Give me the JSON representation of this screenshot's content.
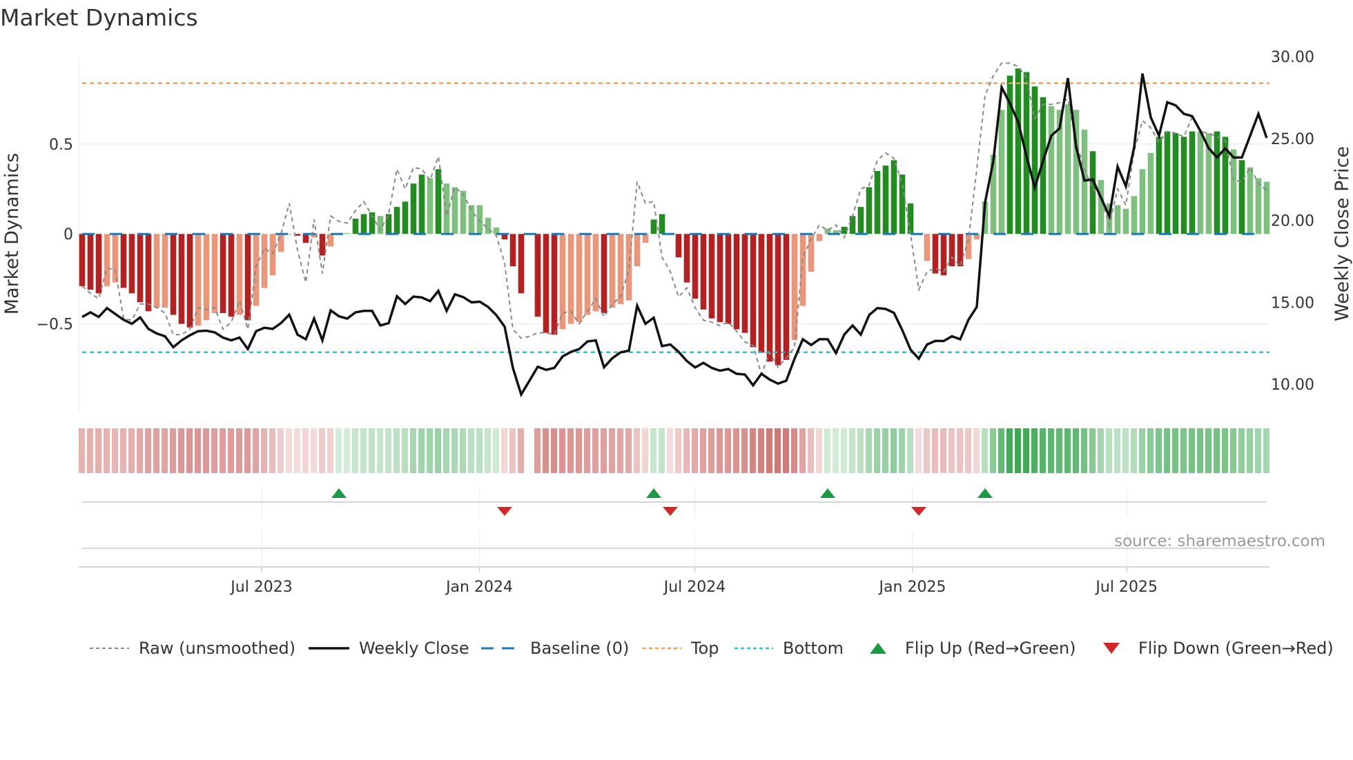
{
  "title": "Market Dynamics",
  "chart_data": {
    "type": "bar",
    "title": "Market Dynamics",
    "frequency": "weekly",
    "x_start": "2023-01-30",
    "ylabel_left": "Market Dynamics",
    "ylabel_right": "Weekly Close Price",
    "ylim_left": [
      -1.0,
      0.99
    ],
    "ylim_right": [
      8.2,
      30.04
    ],
    "yticks_left": [
      {
        "v": 0.5,
        "label": "0.5"
      },
      {
        "v": 0,
        "label": "0"
      },
      {
        "v": -0.5,
        "label": "−0.5"
      }
    ],
    "yticks_right": [
      {
        "v": 30,
        "label": "30.00"
      },
      {
        "v": 25,
        "label": "25.00"
      },
      {
        "v": 20,
        "label": "20.00"
      },
      {
        "v": 15,
        "label": "15.00"
      },
      {
        "v": 10,
        "label": "10.00"
      }
    ],
    "xticks": [
      {
        "week": 21.67,
        "label": "Jul 2023"
      },
      {
        "week": 47.96,
        "label": "Jan 2024"
      },
      {
        "week": 73.96,
        "label": "Jul 2024"
      },
      {
        "week": 100.25,
        "label": "Jan 2025"
      },
      {
        "week": 126.1,
        "label": "Jul 2025"
      }
    ],
    "top_level": 0.838,
    "bottom_level": -0.658,
    "baseline": 0,
    "colors": {
      "pos_strong": "#228b22",
      "pos_weak": "#7fbf7f",
      "neg_strong": "#b22222",
      "neg_weak": "#e9967a",
      "top": "#f0a050",
      "bottom": "#22c5d5",
      "baseline": "#1f77b4",
      "raw": "#888888",
      "close": "#111111",
      "flip_up": "#1a9a45",
      "flip_down": "#d62728"
    },
    "dynamics": [
      -0.29,
      -0.31,
      -0.33,
      -0.29,
      -0.27,
      -0.3,
      -0.33,
      -0.38,
      -0.43,
      -0.41,
      -0.41,
      -0.45,
      -0.5,
      -0.52,
      -0.51,
      -0.48,
      -0.44,
      -0.44,
      -0.46,
      -0.45,
      -0.48,
      -0.4,
      -0.3,
      -0.23,
      -0.1,
      -0.003,
      -0.01,
      -0.05,
      -0.02,
      -0.12,
      -0.07,
      0.005,
      0.005,
      0.085,
      0.11,
      0.12,
      0.1,
      0.11,
      0.15,
      0.18,
      0.28,
      0.33,
      0.31,
      0.36,
      0.28,
      0.26,
      0.24,
      0.16,
      0.16,
      0.09,
      0.036,
      -0.03,
      -0.18,
      -0.33,
      null,
      -0.46,
      -0.55,
      -0.56,
      -0.53,
      -0.5,
      -0.49,
      -0.45,
      -0.43,
      -0.44,
      -0.41,
      -0.39,
      -0.37,
      -0.18,
      -0.05,
      0.08,
      0.11,
      -0.004,
      -0.13,
      -0.27,
      -0.36,
      -0.42,
      -0.47,
      -0.49,
      -0.5,
      -0.53,
      -0.55,
      -0.63,
      -0.66,
      -0.71,
      -0.73,
      -0.7,
      -0.59,
      -0.4,
      -0.21,
      -0.04,
      0.03,
      0.02,
      0.04,
      0.1,
      0.15,
      0.26,
      0.35,
      0.38,
      0.41,
      0.33,
      0.17,
      -0.004,
      -0.15,
      -0.22,
      -0.23,
      -0.18,
      -0.18,
      -0.14,
      -0.03,
      0.18,
      0.44,
      0.69,
      0.88,
      0.92,
      0.9,
      0.82,
      0.76,
      0.71,
      0.69,
      0.72,
      0.69,
      0.58,
      0.46,
      0.3,
      0.17,
      0.16,
      0.14,
      0.21,
      0.36,
      0.45,
      0.54,
      0.57,
      0.56,
      0.54,
      0.57,
      0.57,
      0.56,
      0.57,
      0.54,
      0.47,
      0.41,
      0.37,
      0.31,
      0.29
    ],
    "shade": "dddllddddlldddlllddldlllllddldllldddldddddldllllllldddldddllllldllllldddddddddddddddddlllllldddddddddllddddllllldddddllllldllllllldddddllddldllllll",
    "raw": [
      -0.29,
      -0.33,
      -0.36,
      -0.19,
      -0.2,
      -0.47,
      -0.48,
      -0.39,
      -0.39,
      -0.41,
      -0.44,
      -0.56,
      -0.56,
      -0.53,
      -0.41,
      -0.42,
      -0.41,
      -0.53,
      -0.49,
      -0.37,
      -0.53,
      -0.18,
      -0.08,
      -0.11,
      0,
      0.17,
      -0.09,
      -0.27,
      0.08,
      -0.22,
      0.1,
      0.07,
      0.06,
      0.13,
      0.18,
      0.1,
      0.02,
      0.11,
      0.36,
      0.25,
      0.37,
      0.36,
      0.3,
      0.43,
      0.1,
      0.26,
      0.22,
      0.13,
      0.07,
      0.03,
      -0.01,
      -0.16,
      -0.53,
      -0.58,
      -0.57,
      -0.55,
      -0.55,
      -0.56,
      -0.44,
      -0.43,
      -0.5,
      -0.43,
      -0.36,
      -0.46,
      -0.39,
      -0.35,
      -0.2,
      0.29,
      0.17,
      0.18,
      -0.13,
      -0.21,
      -0.35,
      -0.3,
      -0.41,
      -0.48,
      -0.49,
      -0.51,
      -0.49,
      -0.54,
      -0.6,
      -0.62,
      -0.78,
      -0.66,
      -0.74,
      -0.69,
      -0.63,
      -0.13,
      -0.03,
      0.05,
      0.02,
      0.05,
      -0.02,
      0.1,
      0.25,
      0.27,
      0.41,
      0.45,
      0.42,
      0.28,
      0,
      -0.31,
      -0.21,
      -0.19,
      -0.21,
      -0.13,
      -0.18,
      -0.03,
      0.36,
      0.77,
      0.88,
      0.95,
      0.95,
      0.93,
      0.87,
      0.64,
      0.72,
      0.72,
      0.73,
      0.75,
      0.51,
      0.36,
      0.25,
      0.2,
      0.05,
      0.25,
      0.16,
      0.46,
      0.63,
      0.59,
      0.51,
      0.57,
      0.56,
      0.54,
      0.65,
      0.57,
      0.56,
      0.54,
      0.52,
      0.3,
      0.29,
      0.37,
      0.28,
      0.24
    ],
    "close": [
      14.11,
      14.39,
      14.11,
      14.65,
      14.29,
      13.94,
      13.69,
      14.08,
      13.38,
      13.1,
      12.93,
      12.26,
      12.68,
      12.99,
      13.24,
      13.27,
      13.17,
      12.85,
      12.68,
      12.85,
      12.15,
      13.24,
      13.45,
      13.38,
      13.73,
      14.25,
      13.03,
      12.75,
      14.01,
      12.68,
      14.51,
      14.15,
      14.01,
      14.39,
      14.48,
      14.48,
      13.59,
      13.73,
      15.37,
      14.9,
      15.35,
      15.3,
      15.07,
      15.7,
      14.48,
      15.49,
      15.32,
      15.0,
      15.04,
      14.72,
      14.22,
      13.52,
      11.0,
      9.38,
      10.22,
      11.07,
      10.88,
      11.0,
      11.7,
      11.98,
      12.15,
      12.61,
      12.68,
      11.04,
      11.59,
      11.95,
      12.05,
      14.79,
      13.69,
      14.06,
      12.33,
      12.43,
      11.98,
      11.42,
      11.03,
      11.31,
      11.0,
      10.83,
      10.93,
      10.64,
      10.6,
      9.94,
      10.64,
      10.29,
      10.04,
      10.22,
      11.56,
      12.75,
      12.4,
      12.75,
      12.75,
      11.91,
      13.03,
      13.59,
      13.03,
      14.22,
      14.65,
      14.6,
      14.36,
      13.31,
      12.12,
      11.56,
      12.43,
      12.65,
      12.64,
      12.93,
      12.75,
      13.94,
      14.72,
      21.1,
      23.63,
      28.12,
      27.14,
      26.01,
      23.91,
      22.01,
      23.63,
      25.17,
      25.62,
      28.68,
      24.47,
      22.43,
      22.5,
      21.38,
      20.26,
      23.28,
      22.08,
      24.47,
      28.96,
      26.29,
      25.17,
      27.21,
      27.02,
      26.5,
      26.36,
      25.45,
      24.4,
      23.84,
      24.4,
      23.84,
      23.84,
      25.17,
      26.5,
      25.03
    ],
    "flip_up_weeks": [
      31,
      69,
      90,
      109
    ],
    "flip_down_weeks": [
      51,
      71,
      101
    ],
    "source": "source: sharemaestro.com",
    "legend": {
      "position": "bottom",
      "items": [
        "Raw (unsmoothed)",
        "Weekly Close",
        "Baseline (0)",
        "Top",
        "Bottom",
        "Flip Up (Red→Green)",
        "Flip Down (Green→Red)"
      ]
    }
  }
}
